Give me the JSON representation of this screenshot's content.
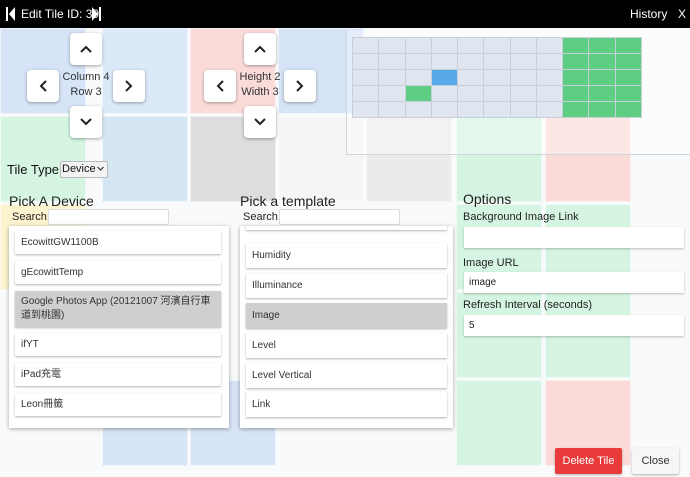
{
  "titlebar": {
    "title": "Edit Tile ID: 39",
    "history_label": "History",
    "close_label": "X"
  },
  "position_control": {
    "column_text": "Column 4",
    "row_text": "Row 3"
  },
  "size_control": {
    "height_text": "Height 2",
    "width_text": "Width 3"
  },
  "grid_preview": {
    "columns": 11,
    "rows": 5,
    "cells": [
      "c",
      "c",
      "c",
      "c",
      "c",
      "c",
      "c",
      "c",
      "g",
      "g",
      "g",
      "c",
      "c",
      "c",
      "c",
      "c",
      "c",
      "c",
      "c",
      "g",
      "g",
      "g",
      "c",
      "c",
      "c",
      "b",
      "c",
      "c",
      "c",
      "c",
      "g",
      "g",
      "g",
      "c",
      "c",
      "g",
      "c",
      "c",
      "c",
      "c",
      "c",
      "g",
      "g",
      "g",
      "c",
      "c",
      "c",
      "c",
      "c",
      "c",
      "c",
      "c",
      "g",
      "g",
      "g"
    ],
    "colors": {
      "empty": "#dfe6ef",
      "occupied": "#5ece82",
      "current": "#58a9ea"
    }
  },
  "tile_type": {
    "label": "Tile Type:",
    "selected": "Device"
  },
  "device_section": {
    "heading": "Pick A Device",
    "search_label": "Search:",
    "search_value": "",
    "items": [
      "EcowittGW1100B",
      "gEcowittTemp",
      "Google Photos App (20121007 河濱自行車道到桃園)",
      "ifYT",
      "iPad充電",
      "Leon冊籤"
    ],
    "selected_index": 2
  },
  "template_section": {
    "heading": "Pick a template",
    "search_label": "Search:",
    "search_value": "",
    "items": [
      "Humidity",
      "Illuminance",
      "Image",
      "Level",
      "Level Vertical",
      "Link"
    ],
    "selected_index": 2
  },
  "options": {
    "heading": "Options",
    "bg_image_label": "Background Image Link",
    "bg_image_value": "",
    "image_url_label": "Image URL",
    "image_url_value": "image",
    "refresh_label": "Refresh Interval (seconds)",
    "refresh_value": "5"
  },
  "buttons": {
    "delete_label": "Delete Tile",
    "close_label": "Close",
    "delete_color": "#ea3b3b"
  },
  "icons": [
    "prev-icon",
    "next-icon",
    "arrow-up-icon",
    "arrow-down-icon",
    "arrow-left-icon",
    "arrow-right-icon",
    "chevron-down-icon"
  ]
}
